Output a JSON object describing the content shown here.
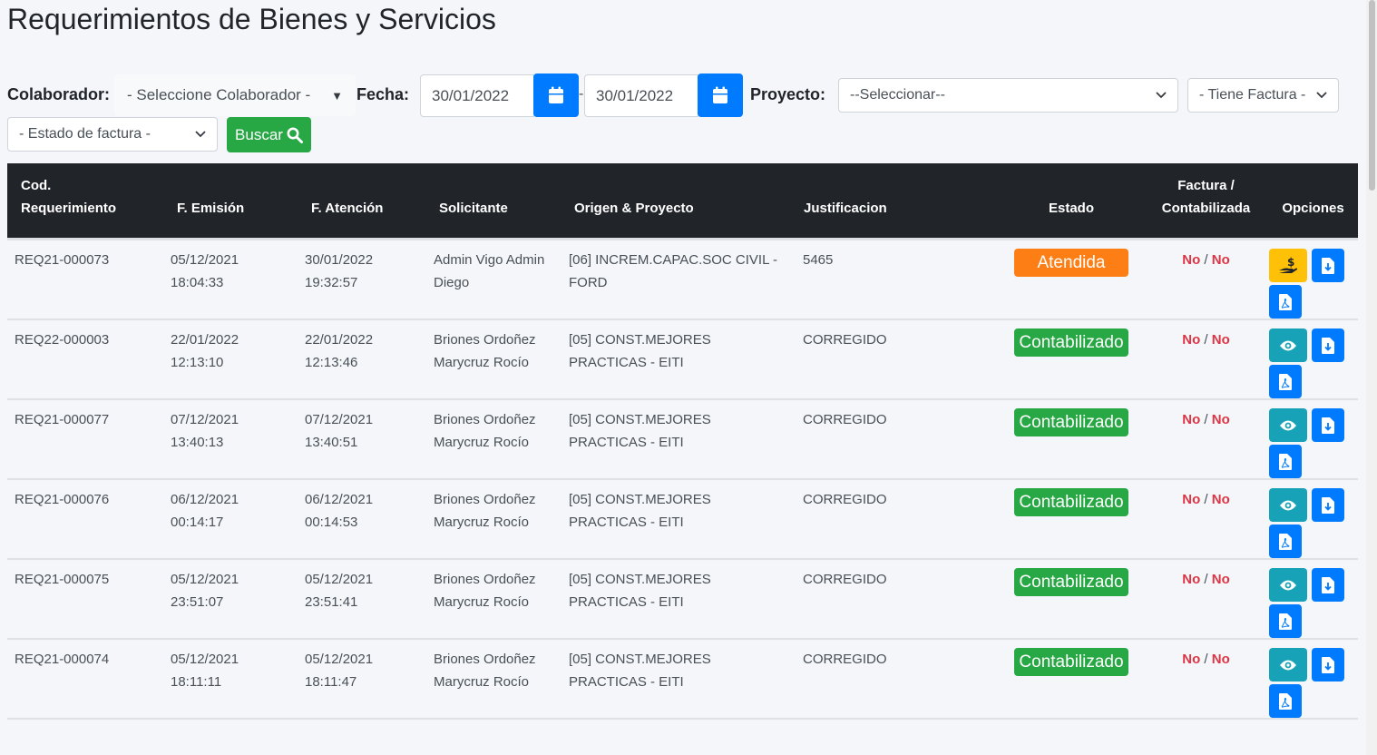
{
  "page": {
    "title": "Requerimientos de Bienes y Servicios"
  },
  "filters": {
    "colaborador_label": "Colaborador:",
    "colaborador_value": "- Seleccione Colaborador -",
    "fecha_label": "Fecha:",
    "fecha_desde": "30/01/2022",
    "fecha_hasta": "30/01/2022",
    "dash": "-",
    "proyecto_label": "Proyecto:",
    "proyecto_value": "--Seleccionar--",
    "tiene_factura_value": "- Tiene Factura -",
    "estado_factura_value": "- Estado de factura -",
    "buscar_label": "Buscar"
  },
  "table": {
    "headers": [
      "Cod. Requerimiento",
      "F. Emisión",
      "F. Atención",
      "Solicitante",
      "Origen & Proyecto",
      "Justificacion",
      "Estado",
      "Factura / Contabilizada",
      "Opciones"
    ],
    "rows": [
      {
        "cod": "REQ21-000073",
        "emision_fecha": "05/12/2021",
        "emision_hora": "18:04:33",
        "atencion_fecha": "30/01/2022",
        "atencion_hora": "19:32:57",
        "solicitante": "Admin Vigo Admin Diego",
        "origen": "[06] INCREM.CAPAC.SOC CIVIL - FORD",
        "justificacion": "5465",
        "estado": "Atendida",
        "estado_color": "#fd7e14",
        "factura": "No",
        "contabilizada": "No",
        "first_action": "pay"
      },
      {
        "cod": "REQ22-000003",
        "emision_fecha": "22/01/2022",
        "emision_hora": "12:13:10",
        "atencion_fecha": "22/01/2022",
        "atencion_hora": "12:13:46",
        "solicitante": "Briones Ordoñez Marycruz Rocío",
        "origen": "[05] CONST.MEJORES PRACTICAS - EITI",
        "justificacion": "CORREGIDO",
        "estado": "Contabilizado",
        "estado_color": "#28a745",
        "factura": "No",
        "contabilizada": "No",
        "first_action": "view"
      },
      {
        "cod": "REQ21-000077",
        "emision_fecha": "07/12/2021",
        "emision_hora": "13:40:13",
        "atencion_fecha": "07/12/2021",
        "atencion_hora": "13:40:51",
        "solicitante": "Briones Ordoñez Marycruz Rocío",
        "origen": "[05] CONST.MEJORES PRACTICAS - EITI",
        "justificacion": "CORREGIDO",
        "estado": "Contabilizado",
        "estado_color": "#28a745",
        "factura": "No",
        "contabilizada": "No",
        "first_action": "view"
      },
      {
        "cod": "REQ21-000076",
        "emision_fecha": "06/12/2021",
        "emision_hora": "00:14:17",
        "atencion_fecha": "06/12/2021",
        "atencion_hora": "00:14:53",
        "solicitante": "Briones Ordoñez Marycruz Rocío",
        "origen": "[05] CONST.MEJORES PRACTICAS - EITI",
        "justificacion": "CORREGIDO",
        "estado": "Contabilizado",
        "estado_color": "#28a745",
        "factura": "No",
        "contabilizada": "No",
        "first_action": "view"
      },
      {
        "cod": "REQ21-000075",
        "emision_fecha": "05/12/2021",
        "emision_hora": "23:51:07",
        "atencion_fecha": "05/12/2021",
        "atencion_hora": "23:51:41",
        "solicitante": "Briones Ordoñez Marycruz Rocío",
        "origen": "[05] CONST.MEJORES PRACTICAS - EITI",
        "justificacion": "CORREGIDO",
        "estado": "Contabilizado",
        "estado_color": "#28a745",
        "factura": "No",
        "contabilizada": "No",
        "first_action": "view"
      },
      {
        "cod": "REQ21-000074",
        "emision_fecha": "05/12/2021",
        "emision_hora": "18:11:11",
        "atencion_fecha": "05/12/2021",
        "atencion_hora": "18:11:47",
        "solicitante": "Briones Ordoñez Marycruz Rocío",
        "origen": "[05] CONST.MEJORES PRACTICAS - EITI",
        "justificacion": "CORREGIDO",
        "estado": "Contabilizado",
        "estado_color": "#28a745",
        "factura": "No",
        "contabilizada": "No",
        "first_action": "view"
      }
    ]
  },
  "icons": {
    "calendar": "calendar-icon",
    "search": "search-icon",
    "pay": "hand-dollar-icon",
    "view": "eye-icon",
    "download": "file-download-icon",
    "pdf": "file-pdf-icon",
    "caret": "caret-down-icon"
  },
  "colors": {
    "primary": "#007bff",
    "success": "#28a745",
    "warning": "#ffc107",
    "info": "#17a2b8",
    "orange": "#fd7e14",
    "danger": "#dc3545",
    "header": "#212529"
  }
}
